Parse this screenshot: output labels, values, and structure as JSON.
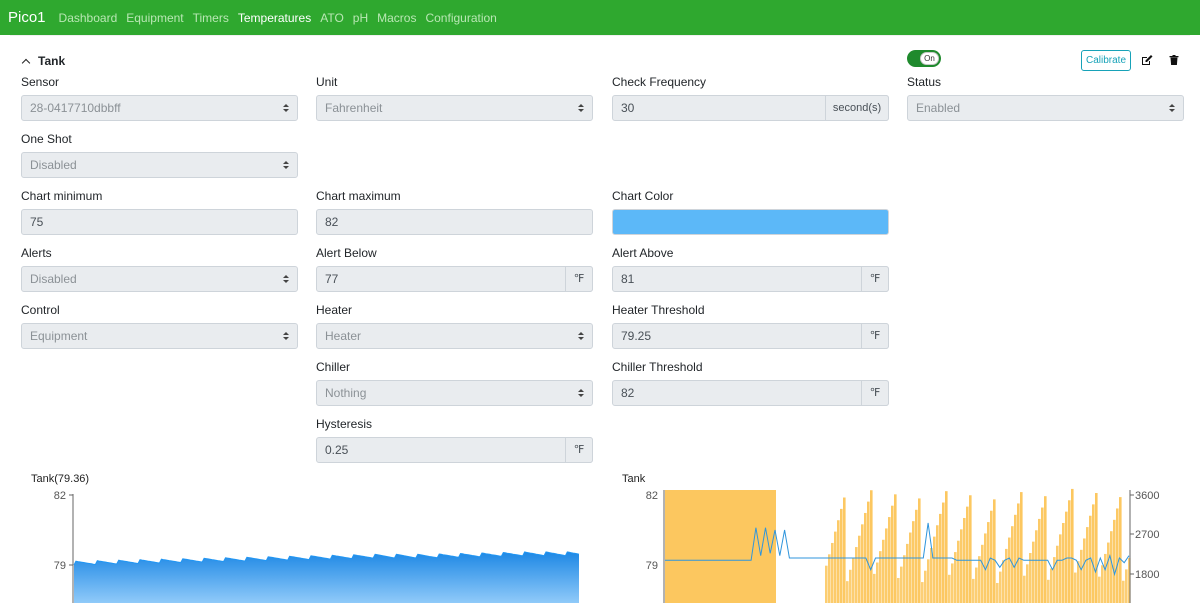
{
  "nav": {
    "brand": "Pico1",
    "items": [
      {
        "label": "Dashboard",
        "active": false
      },
      {
        "label": "Equipment",
        "active": false
      },
      {
        "label": "Timers",
        "active": false
      },
      {
        "label": "Temperatures",
        "active": true
      },
      {
        "label": "ATO",
        "active": false
      },
      {
        "label": "pH",
        "active": false
      },
      {
        "label": "Macros",
        "active": false
      },
      {
        "label": "Configuration",
        "active": false
      }
    ]
  },
  "panel": {
    "title": "Tank",
    "toggle_label": "On",
    "toggle_on": true,
    "calibrate_label": "Calibrate"
  },
  "form": {
    "sensor": {
      "label": "Sensor",
      "value": "28-0417710dbbff"
    },
    "unit": {
      "label": "Unit",
      "value": "Fahrenheit"
    },
    "check_frequency": {
      "label": "Check Frequency",
      "value": "30",
      "addon": "second(s)"
    },
    "status": {
      "label": "Status",
      "value": "Enabled"
    },
    "one_shot": {
      "label": "One Shot",
      "value": "Disabled"
    },
    "chart_min": {
      "label": "Chart minimum",
      "value": "75"
    },
    "chart_max": {
      "label": "Chart maximum",
      "value": "82"
    },
    "chart_color": {
      "label": "Chart Color",
      "value": "#5cb8f8"
    },
    "alerts": {
      "label": "Alerts",
      "value": "Disabled"
    },
    "alert_below": {
      "label": "Alert Below",
      "value": "77",
      "addon": "℉"
    },
    "alert_above": {
      "label": "Alert Above",
      "value": "81",
      "addon": "℉"
    },
    "control": {
      "label": "Control",
      "value": "Equipment"
    },
    "heater": {
      "label": "Heater",
      "value": "Heater"
    },
    "heater_threshold": {
      "label": "Heater Threshold",
      "value": "79.25",
      "addon": "℉"
    },
    "chiller": {
      "label": "Chiller",
      "value": "Nothing"
    },
    "chiller_threshold": {
      "label": "Chiller Threshold",
      "value": "82",
      "addon": "℉"
    },
    "hysteresis": {
      "label": "Hysteresis",
      "value": "0.25",
      "addon": "℉"
    }
  },
  "chart_data": [
    {
      "type": "area",
      "title": "Tank(79.36)",
      "y_ticks": [
        "82",
        "79"
      ],
      "ylim": [
        77.5,
        82
      ],
      "color": "#2196f3",
      "series": [
        {
          "values": [
            79.0,
            79.05,
            79.1,
            79.15,
            79.2,
            79.25,
            79.3,
            79.3,
            79.35,
            79.4,
            79.4
          ]
        }
      ]
    },
    {
      "type": "line",
      "title": "Tank",
      "y_ticks_left": [
        "82",
        "79"
      ],
      "y_ticks_right": [
        "3600",
        "2700",
        "1800"
      ],
      "ylim": [
        77.5,
        82
      ],
      "ylim_right": [
        1200,
        3700
      ],
      "line_color": "#2f95dc",
      "usage_color": "#fcc75f",
      "series": [
        {
          "values": [
            79.2,
            79.2,
            79.2,
            79.2,
            79.2,
            79.2,
            79.2,
            79.2,
            79.2,
            79.2,
            79.2,
            79.2,
            79.2,
            79.2,
            79.2,
            79.2,
            79.2,
            79.2,
            79.2,
            80.6,
            79.4,
            80.6,
            79.5,
            80.5,
            79.4,
            80.5,
            79.3,
            79.3,
            79.3,
            79.3,
            79.3,
            79.3,
            79.3,
            79.3,
            79.3,
            79.3,
            79.3,
            79.3,
            79.3,
            79.3,
            79.3,
            79.3,
            79.3,
            78.8,
            79.3,
            79.3,
            79.3,
            79.3,
            79.3,
            79.3,
            79.3,
            79.3,
            79.3,
            79.3,
            79.3,
            80.8,
            79.3,
            79.3,
            79.3,
            79.3,
            79.3,
            79.2,
            79.2,
            79.2,
            79.2,
            79.2,
            79.2,
            78.8,
            79.3,
            79.2,
            78.9,
            79.2,
            79.3,
            78.9,
            79.3,
            79.2,
            79.2,
            79.2,
            79.2,
            79.2,
            79.2,
            78.8,
            79.2,
            79.2,
            79.3,
            79.3,
            79.2,
            78.8,
            79.2,
            79.3,
            78.7,
            79.3,
            78.8,
            79.4,
            78.6,
            79.3,
            79.1,
            79.4
          ]
        }
      ]
    }
  ]
}
